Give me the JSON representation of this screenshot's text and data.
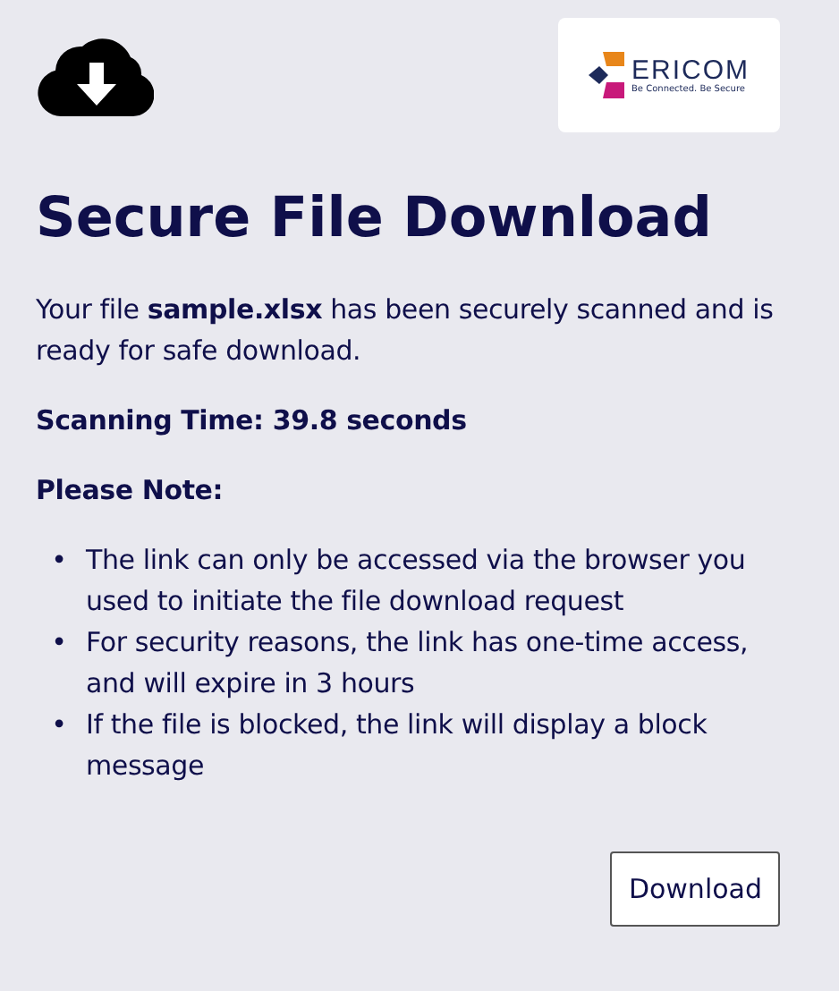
{
  "logo": {
    "name": "ERICOM",
    "tagline": "Be Connected. Be Secure"
  },
  "title": "Secure File Download",
  "message": "Your file **sample.xlsx** has been securely scanned and is ready for safe download.",
  "scanning_time": "Scanning Time: 39.8 seconds",
  "note_heading": "Please Note:",
  "notes": [
    {
      "bullet": "•",
      "text": "The link can only be accessed via the browser you used to initiate the file download request"
    },
    {
      "bullet": "•",
      "text": "For security reasons, the link has one-time access, and will expire in 3 hours"
    },
    {
      "bullet": "•",
      "text": "If the file is blocked, the link will display a block message"
    }
  ],
  "button": "Download"
}
